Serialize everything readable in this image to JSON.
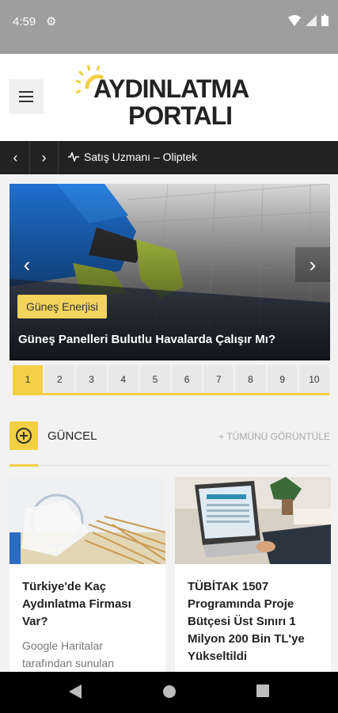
{
  "status_bar": {
    "time": "4:59"
  },
  "header": {
    "logo_line1": "AYDINLATMA",
    "logo_line2": "PORTALI"
  },
  "ticker": {
    "text": "Satış Uzmanı – Oliptek"
  },
  "slider": {
    "category": "Güneş Enerjisi",
    "title": "Güneş Panelleri Bulutlu Havalarda Çalışır Mı?",
    "pages": [
      "1",
      "2",
      "3",
      "4",
      "5",
      "6",
      "7",
      "8",
      "9",
      "10"
    ],
    "active_page": "1"
  },
  "section": {
    "label": "GÜNCEL",
    "view_all": "+ TÜMÜNÜ GÖRÜNTÜLE"
  },
  "cards": [
    {
      "title": "Türkiye'de Kaç Aydınlatma Firması Var?",
      "desc": "Google Haritalar tarafından sunulan"
    },
    {
      "title": "TÜBİTAK 1507 Programında Proje Bütçesi Üst Sınırı 1 Milyon 200 Bin TL'ye Yükseltildi",
      "desc": ""
    }
  ],
  "colors": {
    "accent": "#f2cf45",
    "dark": "#222222"
  }
}
